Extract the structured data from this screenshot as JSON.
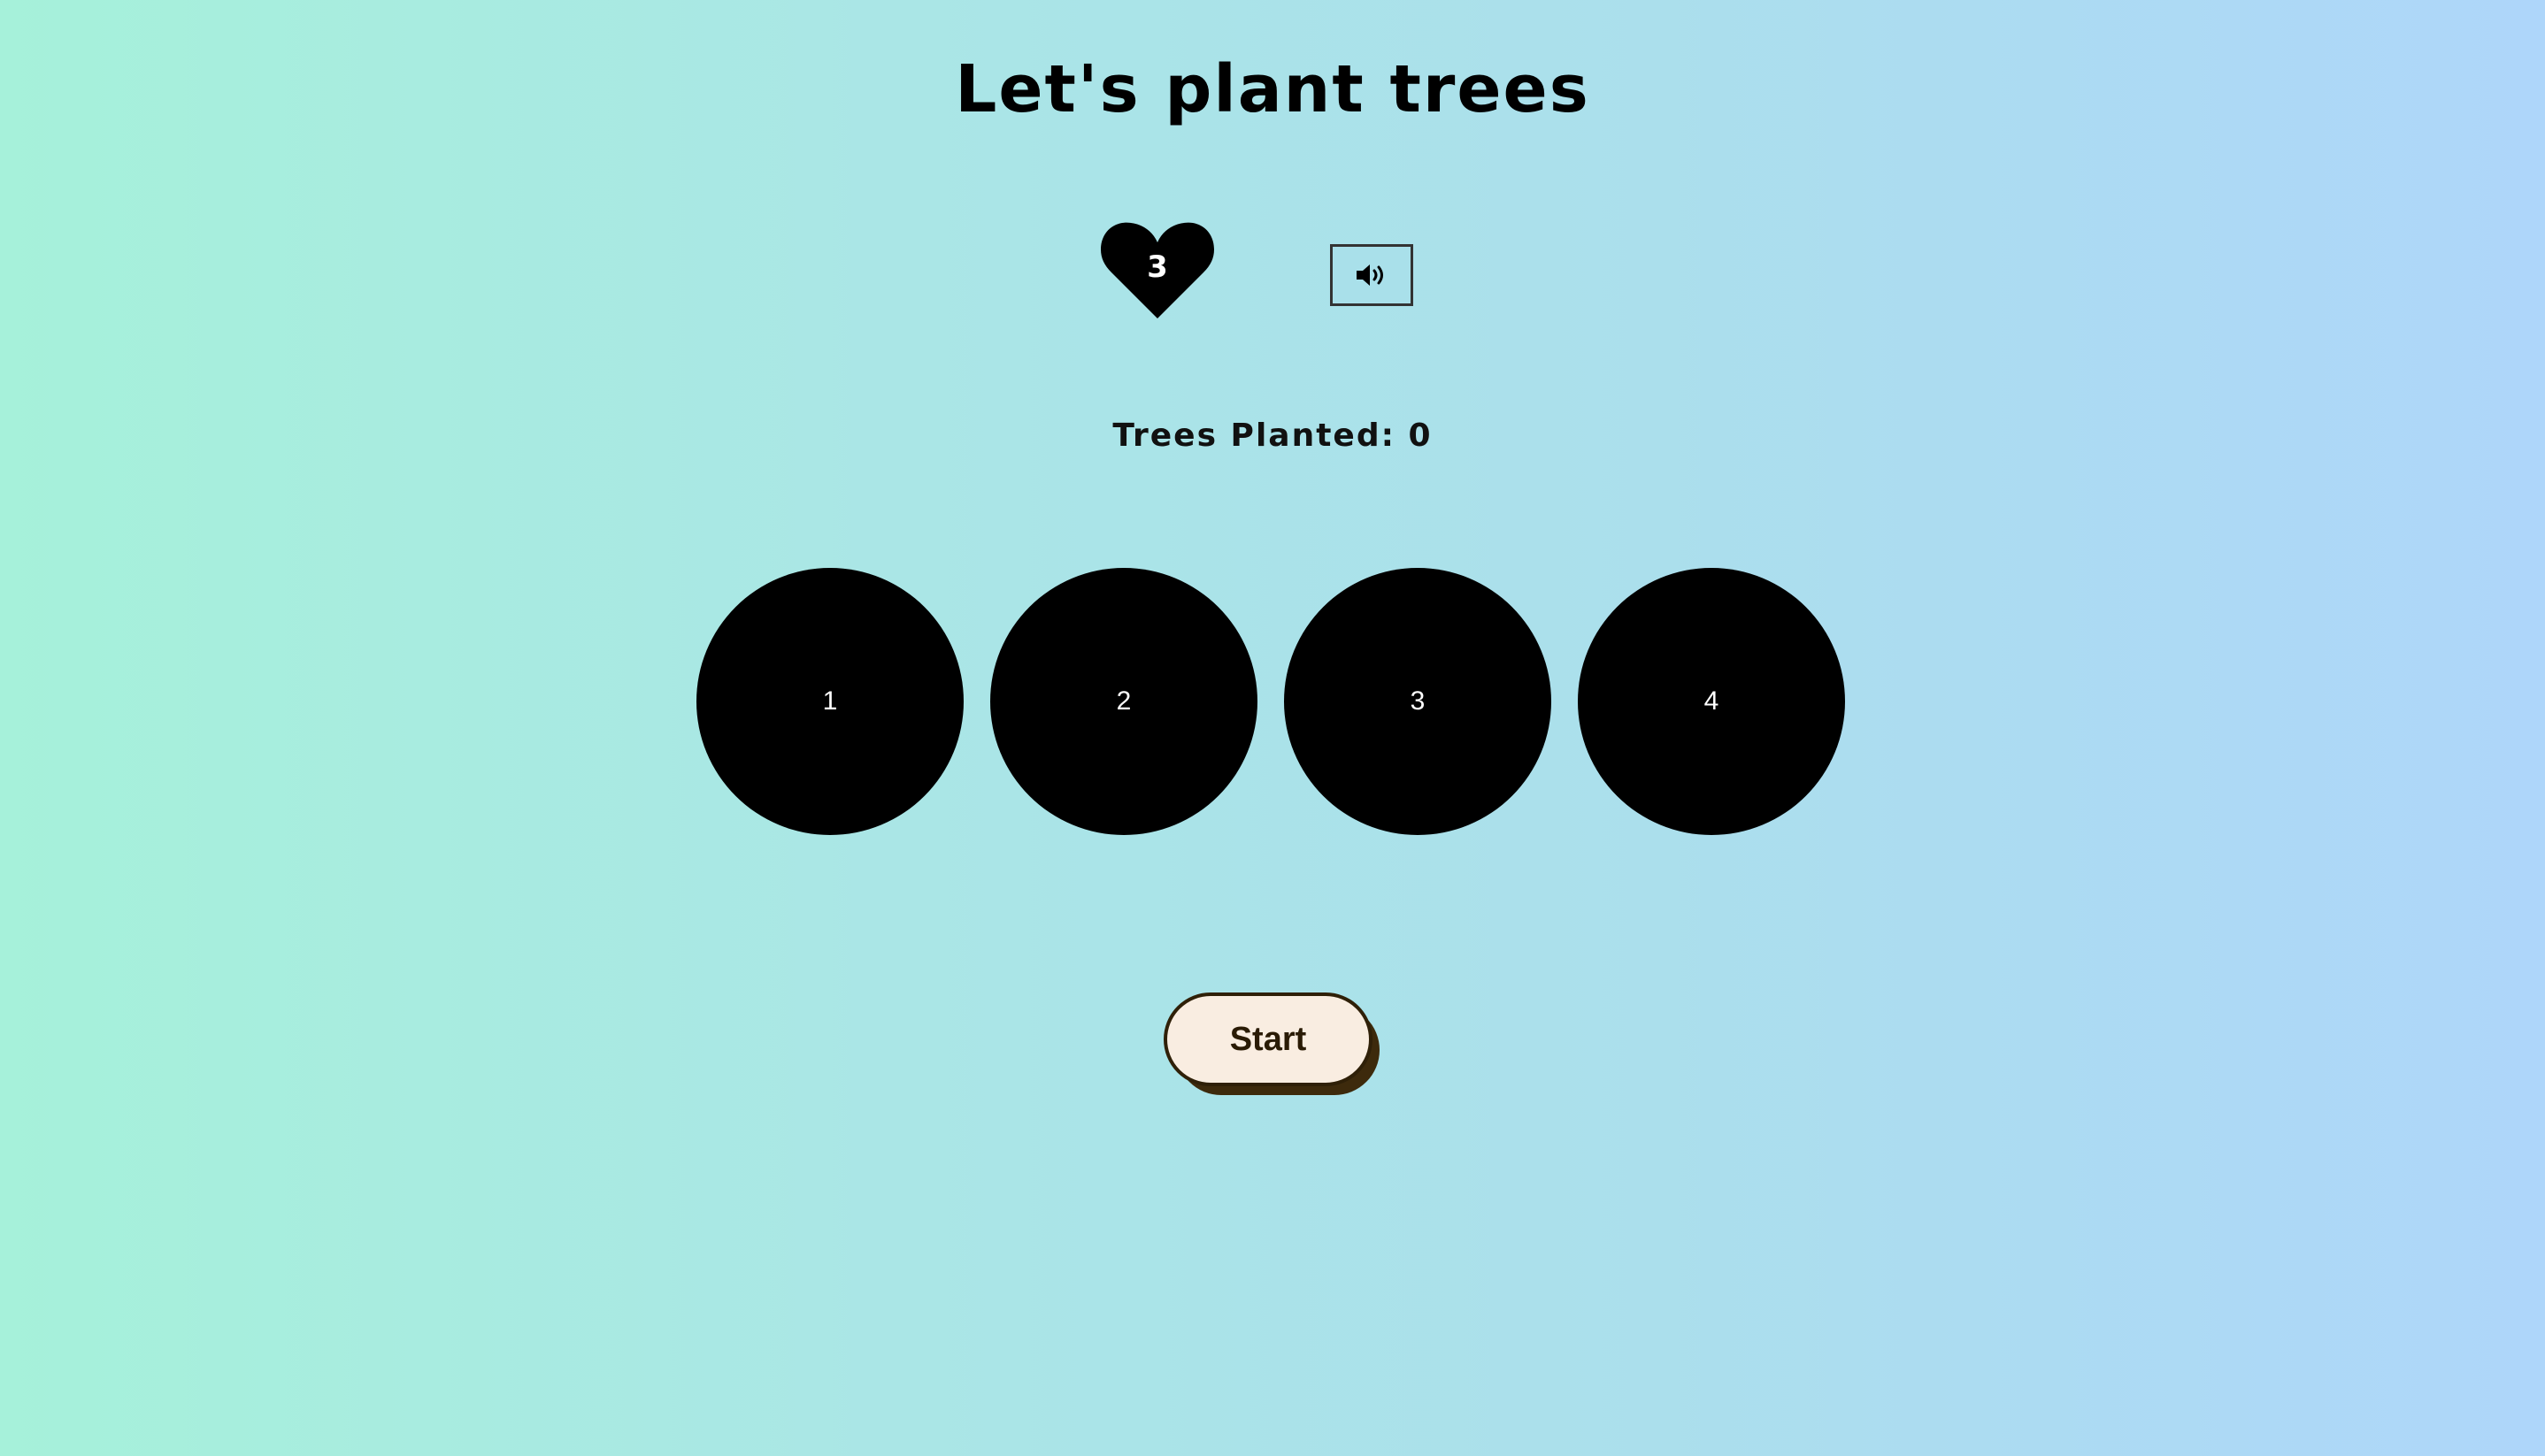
{
  "title": "Let's plant trees",
  "lives": {
    "count": "3",
    "icon": "heart-icon"
  },
  "sound_toggle": {
    "icon": "speaker-volume-icon"
  },
  "score": {
    "text": "Trees Planted: 0"
  },
  "holes": [
    {
      "label": "1"
    },
    {
      "label": "2"
    },
    {
      "label": "3"
    },
    {
      "label": "4"
    }
  ],
  "controls": {
    "start_label": "Start"
  },
  "colors": {
    "background_start": "#a6f1da",
    "background_end": "#aed6fa",
    "hole": "#000000",
    "start_fill": "#f9ede1",
    "start_shadow": "#3d2a0c"
  }
}
